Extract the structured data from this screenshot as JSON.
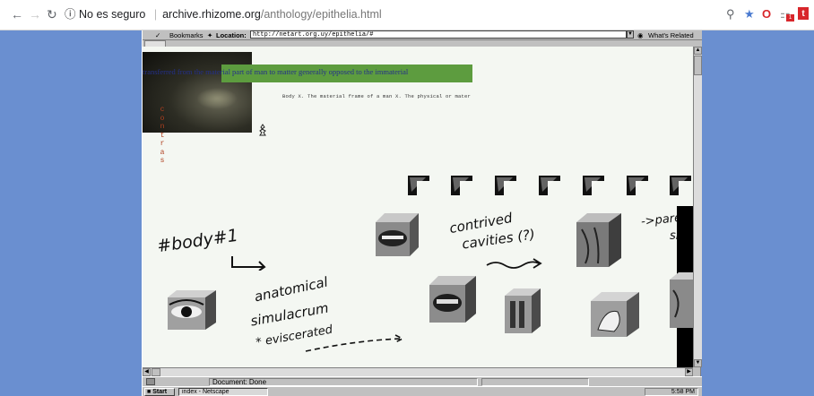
{
  "browser": {
    "back_icon": "arrow-left-icon",
    "forward_icon": "arrow-right-icon",
    "reload_icon": "reload-icon",
    "security_label": "No es seguro",
    "url_host": "archive.rhizome.org",
    "url_path": "/anthology/epithelia.html",
    "extensions": [
      "zoom-icon",
      "star-icon",
      "opera-icon",
      "puzzle-icon",
      "t-icon"
    ],
    "badge_count": "1"
  },
  "netscape": {
    "bookmarks_label": "Bookmarks",
    "location_label": "Location:",
    "location_value": "http://netart.org.uy/epithelia/#",
    "whats_related": "What's Related",
    "status_text": "Document: Done",
    "start_label": "Start",
    "task_label": "index - Netscape",
    "clock": "5:58 PM"
  },
  "artwork": {
    "overlay_text": "transferred from the material part of man to matter generally opposed to the immaterial",
    "body_line": "Body X. The material frame of a man X. The physical or mater",
    "vertical_text": "contras",
    "handwriting": {
      "body1": "#body#1",
      "anatomical": "anatomical",
      "simulacrum": "simulacrum",
      "eviscerated": "* eviscerated",
      "contrived": "contrived",
      "cavities": "cavities (?)",
      "parallel": "->parel",
      "skin": "ski"
    }
  },
  "colors": {
    "chrome_bg": "#ffffff",
    "desktop_bg": "#6a8fd0",
    "win_gray": "#c0c0c0",
    "page_bg": "#f4f7f2",
    "green_bar": "#5d9c3f",
    "overlay_text": "#24308a",
    "vertical_text": "#b04020"
  }
}
